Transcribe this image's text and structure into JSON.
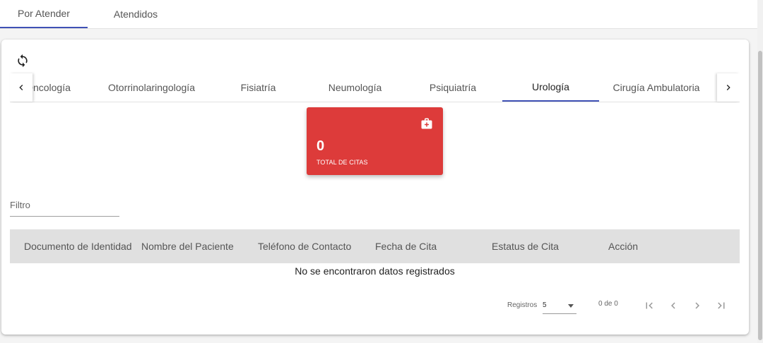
{
  "top_tabs": [
    {
      "label": "Por Atender",
      "active": true
    },
    {
      "label": "Atendidos",
      "active": false
    }
  ],
  "specialty_tabs": [
    {
      "label": "Oncología",
      "active": false
    },
    {
      "label": "Otorrinolaringología",
      "active": false
    },
    {
      "label": "Fisiatría",
      "active": false
    },
    {
      "label": "Neumología",
      "active": false
    },
    {
      "label": "Psiquiatría",
      "active": false
    },
    {
      "label": "Urología",
      "active": true
    },
    {
      "label": "Cirugía Ambulatoria",
      "active": false
    }
  ],
  "icons": {
    "refresh": "refresh-icon",
    "tabs_prev": "chevron-left-icon",
    "tabs_next": "chevron-right-icon",
    "stat": "medical-kit-icon"
  },
  "stat_card": {
    "value": "0",
    "label": "TOTAL DE CITAS",
    "color": "#dd3b3a"
  },
  "filter": {
    "placeholder": "Filtro",
    "value": ""
  },
  "table": {
    "columns": [
      "Documento de Identidad",
      "Nombre del Paciente",
      "Teléfono de Contacto",
      "Fecha de Cita",
      "Estatus de Cita",
      "Acción"
    ],
    "empty_message": "No se encontraron datos registrados"
  },
  "paginator": {
    "page_size_label": "Registros",
    "page_size": "5",
    "range_label": "0 de 0"
  },
  "colors": {
    "accent": "#3f51b5",
    "header_bg": "#e0e0e0"
  }
}
